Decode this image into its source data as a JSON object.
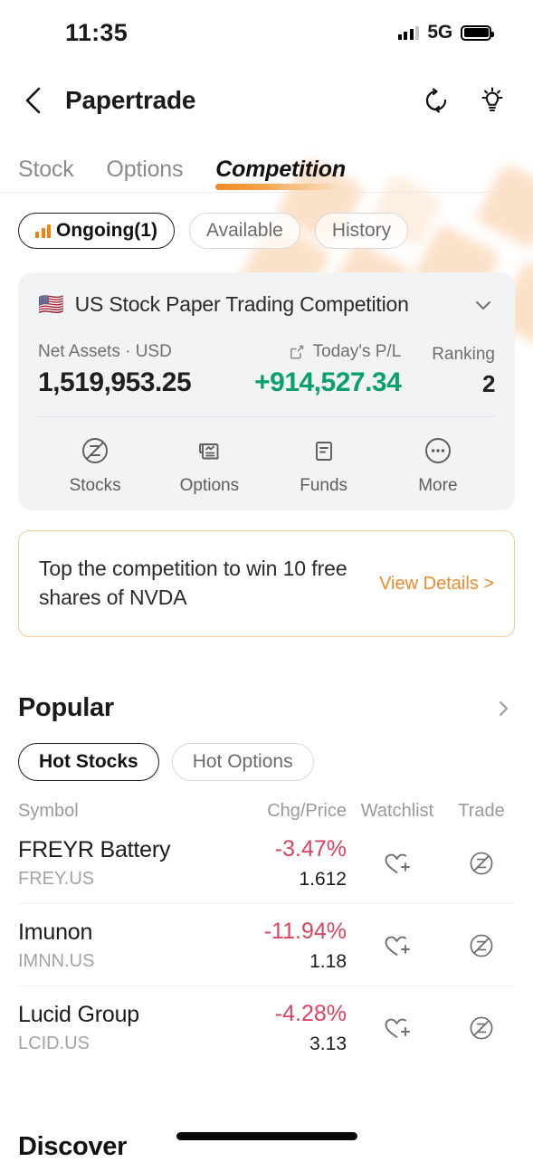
{
  "status_bar": {
    "time": "11:35",
    "network": "5G",
    "signal_icon": "signal-bars-icon",
    "battery_icon": "battery-full-icon"
  },
  "nav": {
    "back_icon": "chevron-left-icon",
    "title": "Papertrade",
    "refresh_icon": "refresh-icon",
    "tips_icon": "lightbulb-icon"
  },
  "tabs": [
    {
      "label": "Stock",
      "active": false
    },
    {
      "label": "Options",
      "active": false
    },
    {
      "label": "Competition",
      "active": true
    }
  ],
  "filter_chips": [
    {
      "label": "Ongoing(1)",
      "active": true,
      "icon": "bar-chart-icon"
    },
    {
      "label": "Available",
      "active": false
    },
    {
      "label": "History",
      "active": false
    }
  ],
  "competition_card": {
    "flag": "🇺🇸",
    "title": "US Stock Paper Trading Competition",
    "collapse_icon": "chevron-down-icon",
    "net_assets_label": "Net Assets · USD",
    "net_assets_value": "1,519,953.25",
    "pl_label": "Today's P/L",
    "pl_value": "+914,527.34",
    "pl_share_icon": "share-icon",
    "ranking_label": "Ranking",
    "ranking_value": "2",
    "positive_color": "#0AA06A",
    "actions": [
      {
        "label": "Stocks",
        "icon": "circle-z-trade-icon"
      },
      {
        "label": "Options",
        "icon": "options-document-icon"
      },
      {
        "label": "Funds",
        "icon": "funds-document-icon"
      },
      {
        "label": "More",
        "icon": "more-dots-icon"
      }
    ]
  },
  "promo": {
    "text": "Top the competition to win 10 free shares of NVDA",
    "link": "View Details >",
    "accent_color": "#ED8A2E"
  },
  "popular": {
    "title": "Popular",
    "more_icon": "chevron-right-icon",
    "chips": [
      {
        "label": "Hot Stocks",
        "active": true
      },
      {
        "label": "Hot Options",
        "active": false
      }
    ],
    "columns": {
      "symbol": "Symbol",
      "change_price": "Chg/Price",
      "watchlist": "Watchlist",
      "trade": "Trade"
    },
    "negative_color": "#D9455F",
    "rows": [
      {
        "name": "FREYR Battery",
        "code": "FREY.US",
        "change": "-3.47%",
        "price": "1.612",
        "watchlist_icon": "heart-plus-icon",
        "trade_icon": "circle-z-trade-icon"
      },
      {
        "name": "Imunon",
        "code": "IMNN.US",
        "change": "-11.94%",
        "price": "1.18",
        "watchlist_icon": "heart-plus-icon",
        "trade_icon": "circle-z-trade-icon"
      },
      {
        "name": "Lucid Group",
        "code": "LCID.US",
        "change": "-4.28%",
        "price": "3.13",
        "watchlist_icon": "heart-plus-icon",
        "trade_icon": "circle-z-trade-icon"
      }
    ]
  },
  "bottom": {
    "next_section_title": "Discover"
  }
}
